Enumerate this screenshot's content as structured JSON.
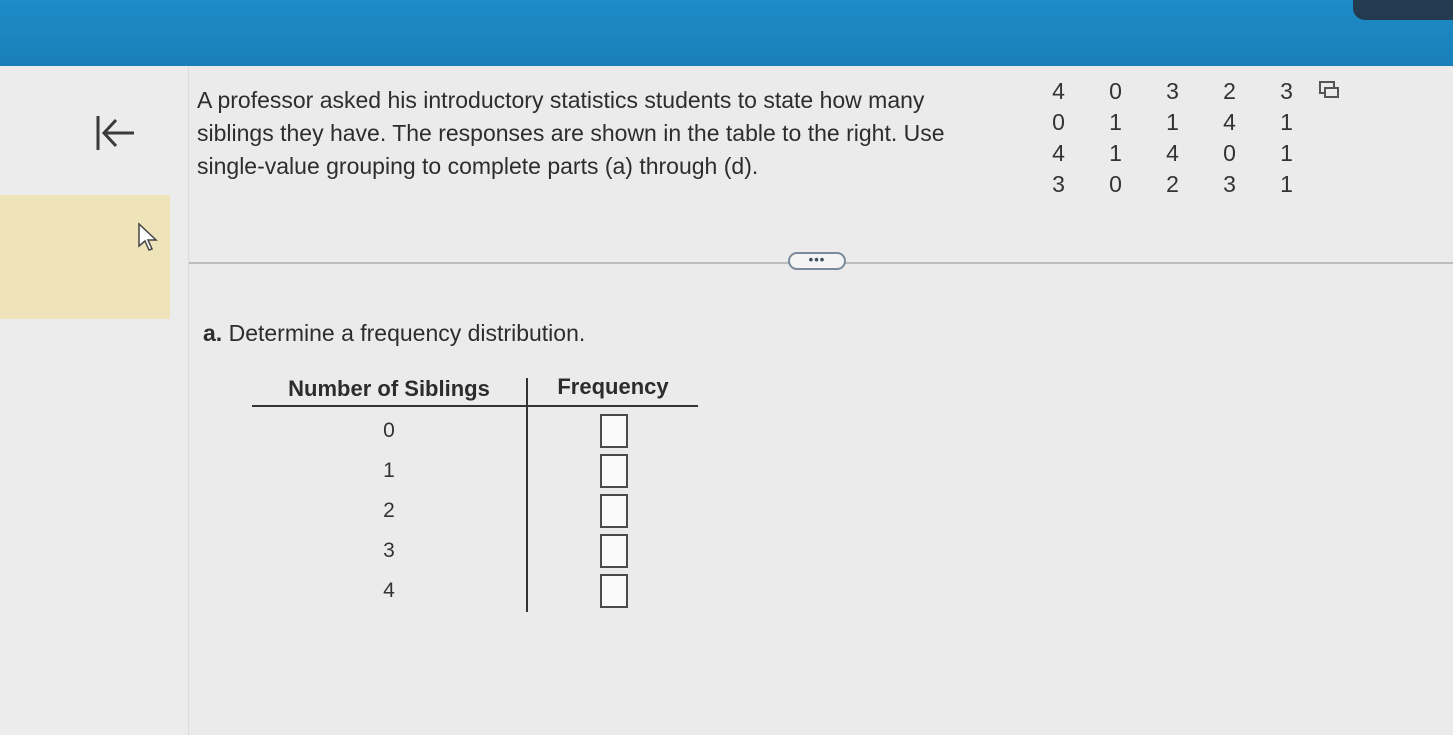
{
  "question": {
    "text": "A professor asked his introductory statistics students to state how many siblings they have. The responses are shown in the table to the right. Use single-value grouping to complete parts (a) through (d)."
  },
  "data_table": {
    "rows": [
      [
        "4",
        "0",
        "3",
        "2",
        "3"
      ],
      [
        "0",
        "1",
        "1",
        "4",
        "1"
      ],
      [
        "4",
        "1",
        "4",
        "0",
        "1"
      ],
      [
        "3",
        "0",
        "2",
        "3",
        "1"
      ]
    ]
  },
  "more_button": {
    "label": "•••"
  },
  "part_a": {
    "letter": "a.",
    "text": "Determine a frequency distribution."
  },
  "freq_table": {
    "col1_header": "Number of Siblings",
    "col2_header": "Frequency",
    "rows": [
      {
        "value": "0"
      },
      {
        "value": "1"
      },
      {
        "value": "2"
      },
      {
        "value": "3"
      },
      {
        "value": "4"
      }
    ]
  },
  "colors": {
    "topbar": "#1d8cc8",
    "highlight": "#efe3ba",
    "background": "#ebebeb"
  },
  "icons": [
    "back-to-start-icon",
    "cursor-icon",
    "copy-data-icon"
  ]
}
